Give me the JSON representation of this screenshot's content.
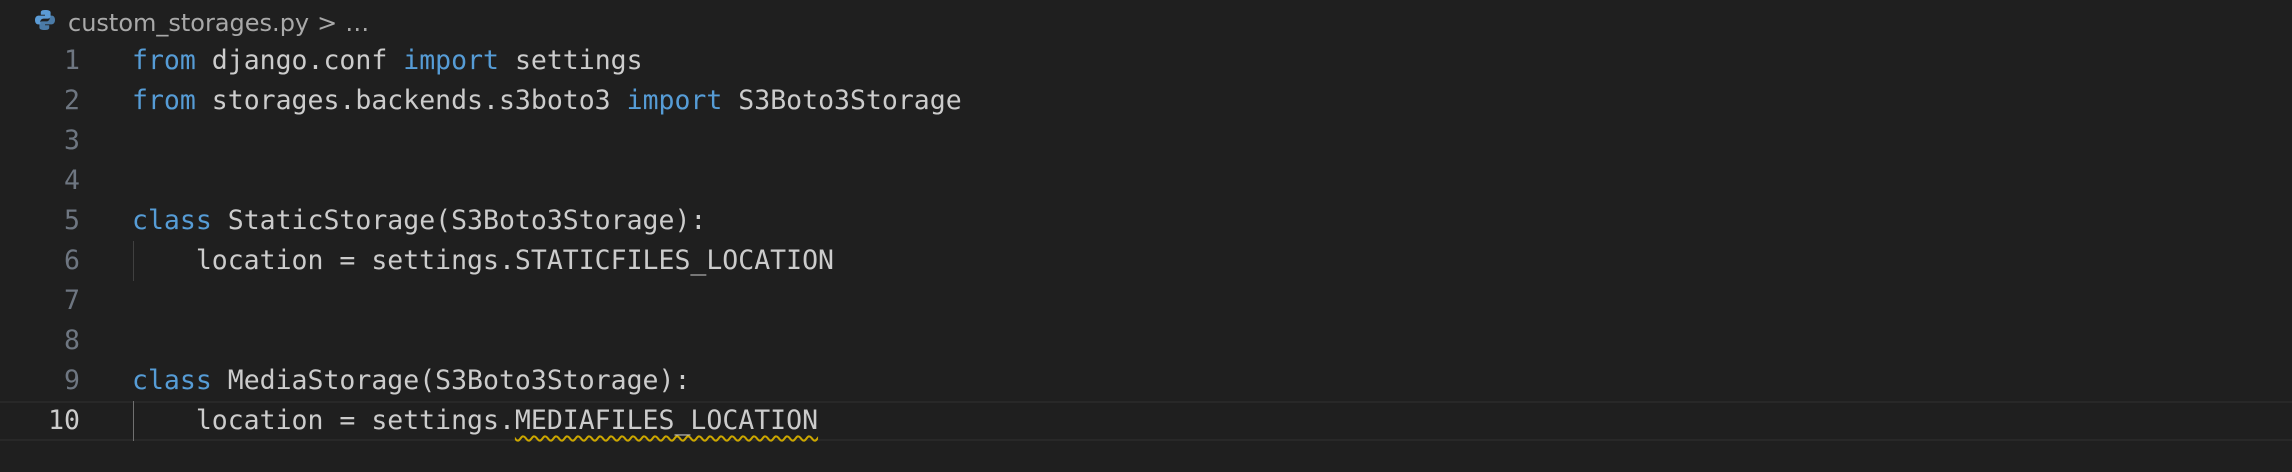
{
  "breadcrumb": {
    "file": "custom_storages.py",
    "separator": ">",
    "more": "…",
    "icon": "python-icon"
  },
  "colors": {
    "background": "#1f1f1f",
    "keyword": "#569cd6",
    "text": "#cccccc",
    "line_number": "#6e7681",
    "warning": "#cca700"
  },
  "active_line": 10,
  "lines": [
    {
      "n": "1",
      "kw1": "from",
      "t1": " django.conf ",
      "kw2": "import",
      "t2": " settings"
    },
    {
      "n": "2",
      "kw1": "from",
      "t1": " storages.backends.s3boto3 ",
      "kw2": "import",
      "t2": " S3Boto3Storage"
    },
    {
      "n": "3"
    },
    {
      "n": "4"
    },
    {
      "n": "5",
      "kw1": "class",
      "t1": " StaticStorage(S3Boto3Storage):"
    },
    {
      "n": "6",
      "t1": "    location = settings.STATICFILES_LOCATION"
    },
    {
      "n": "7"
    },
    {
      "n": "8"
    },
    {
      "n": "9",
      "kw1": "class",
      "t1": " MediaStorage(S3Boto3Storage):"
    },
    {
      "n": "10",
      "t1": "    location = settings.",
      "warn": "MEDIAFILES_LOCATION"
    }
  ]
}
